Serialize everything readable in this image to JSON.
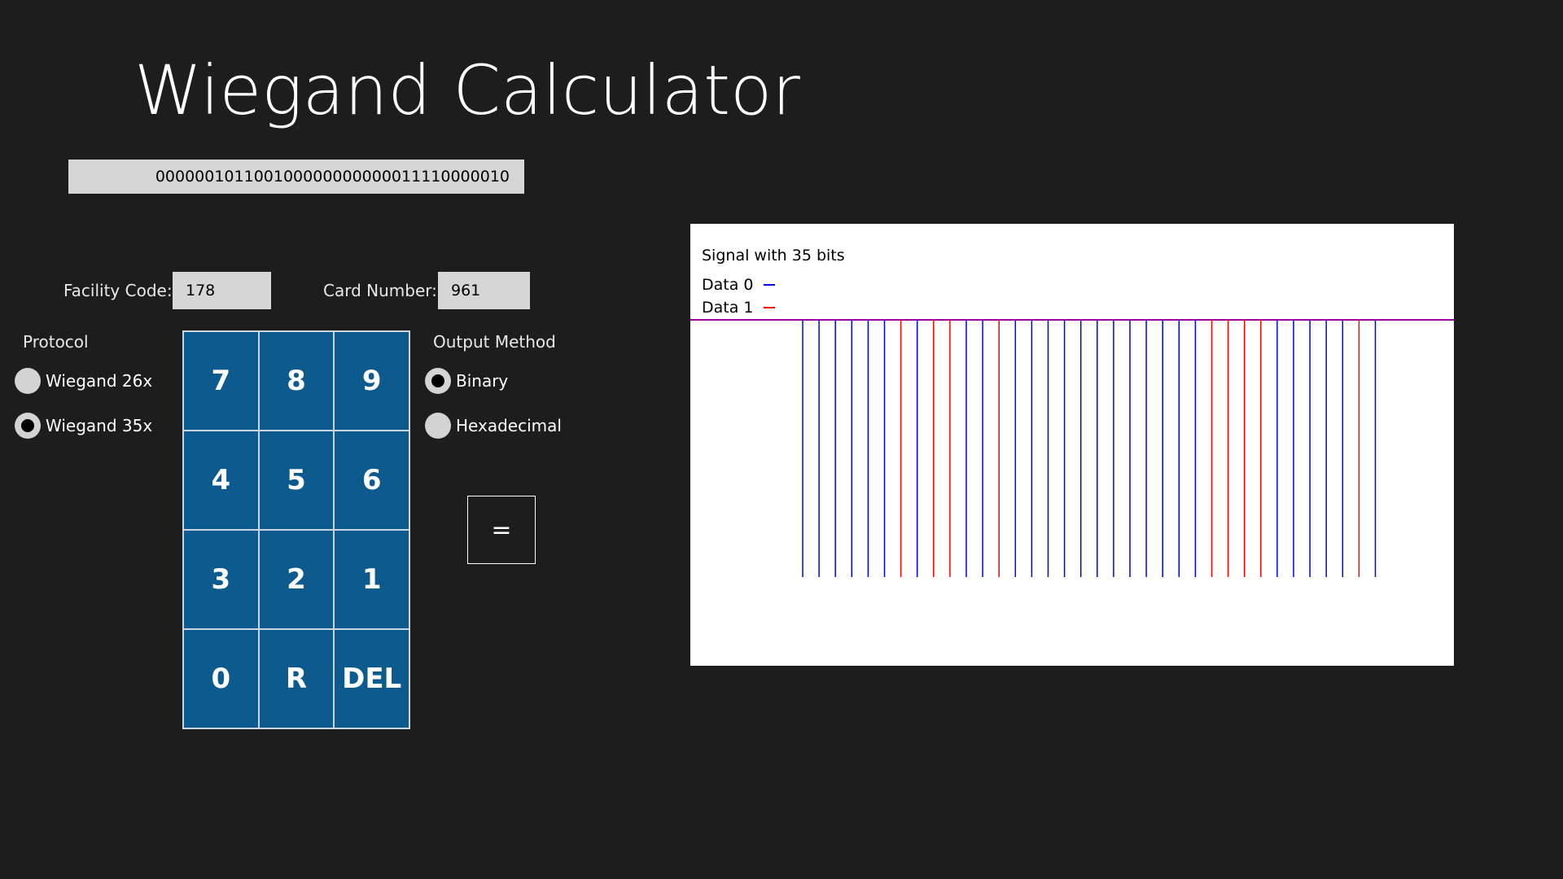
{
  "app": {
    "title": "Wiegand Calculator"
  },
  "output": {
    "binary_value": "000000101100100000000000011110000010"
  },
  "inputs": {
    "facility_code_label": "Facility Code:",
    "facility_code_value": "178",
    "card_number_label": "Card Number:",
    "card_number_value": "961"
  },
  "protocol": {
    "label": "Protocol",
    "options": [
      {
        "label": "Wiegand 26x",
        "selected": false
      },
      {
        "label": "Wiegand 35x",
        "selected": true
      }
    ]
  },
  "output_method": {
    "label": "Output Method",
    "options": [
      {
        "label": "Binary",
        "selected": true
      },
      {
        "label": "Hexadecimal",
        "selected": false
      }
    ]
  },
  "keypad": {
    "keys": [
      "7",
      "8",
      "9",
      "4",
      "5",
      "6",
      "3",
      "2",
      "1",
      "0",
      "R",
      "DEL"
    ]
  },
  "equals_button": {
    "label": "="
  },
  "signal": {
    "title": "Signal with 35 bits",
    "legend": [
      {
        "label": "Data 0",
        "color": "#0000ff"
      },
      {
        "label": "Data 1",
        "color": "#ff0000"
      }
    ],
    "baseline_color": "#a000a0",
    "bits": [
      0,
      0,
      0,
      0,
      0,
      0,
      1,
      0,
      1,
      1,
      0,
      0,
      1,
      0,
      0,
      0,
      0,
      0,
      0,
      0,
      0,
      0,
      0,
      0,
      0,
      1,
      1,
      1,
      1,
      0,
      0,
      0,
      0,
      0,
      1,
      0
    ]
  },
  "colors": {
    "background": "#1d1d1d",
    "keypad_blue": "#0c5a8e",
    "input_gray": "#d6d6d6"
  }
}
